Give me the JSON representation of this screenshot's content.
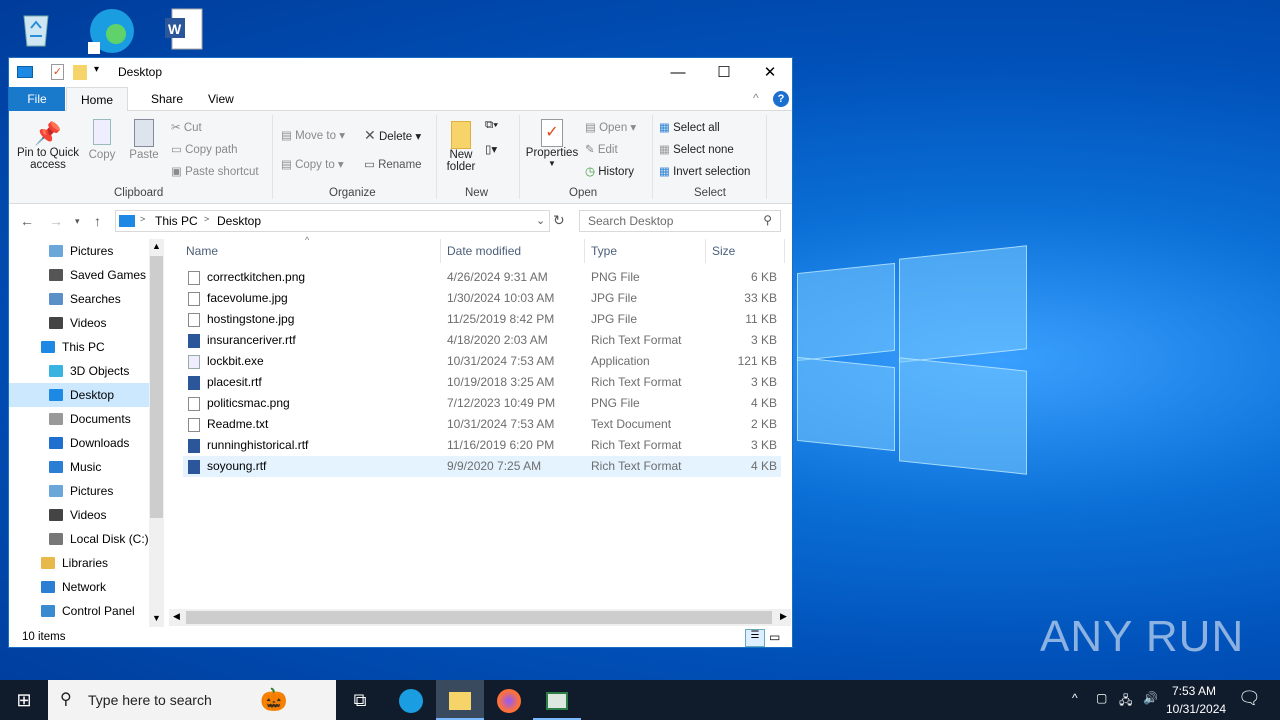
{
  "window": {
    "title": "Desktop",
    "minimize": "—",
    "maximize": "☐",
    "close": "✕"
  },
  "tabs": {
    "file": "File",
    "home": "Home",
    "share": "Share",
    "view": "View"
  },
  "ribbon": {
    "pin": "Pin to Quick access",
    "pin1": "Pin to Quick",
    "pin2": "access",
    "copy": "Copy",
    "paste": "Paste",
    "cut": "Cut",
    "copy_path": "Copy path",
    "paste_shortcut": "Paste shortcut",
    "move_to": "Move to",
    "copy_to": "Copy to",
    "delete": "Delete",
    "rename": "Rename",
    "new_folder1": "New",
    "new_folder2": "folder",
    "properties": "Properties",
    "open": "Open",
    "edit": "Edit",
    "history": "History",
    "select_all": "Select all",
    "select_none": "Select none",
    "invert": "Invert selection",
    "groups": {
      "clipboard": "Clipboard",
      "organize": "Organize",
      "new": "New",
      "open": "Open",
      "select": "Select"
    }
  },
  "address": {
    "crumbs": [
      "This PC",
      "Desktop"
    ],
    "sep": ">",
    "search_placeholder": "Search Desktop"
  },
  "nav": [
    {
      "label": "Pictures",
      "indent": 2,
      "color": "#6aa7d8"
    },
    {
      "label": "Saved Games",
      "indent": 2,
      "color": "#555"
    },
    {
      "label": "Searches",
      "indent": 2,
      "color": "#5a8fc8"
    },
    {
      "label": "Videos",
      "indent": 2,
      "color": "#444"
    },
    {
      "label": "This PC",
      "indent": 1,
      "color": "#1e88e5"
    },
    {
      "label": "3D Objects",
      "indent": 2,
      "color": "#3bb3e0"
    },
    {
      "label": "Desktop",
      "indent": 2,
      "color": "#1e88e5",
      "selected": true
    },
    {
      "label": "Documents",
      "indent": 2,
      "color": "#999"
    },
    {
      "label": "Downloads",
      "indent": 2,
      "color": "#1e6fd0"
    },
    {
      "label": "Music",
      "indent": 2,
      "color": "#2a7fd4"
    },
    {
      "label": "Pictures",
      "indent": 2,
      "color": "#6aa7d8"
    },
    {
      "label": "Videos",
      "indent": 2,
      "color": "#444"
    },
    {
      "label": "Local Disk (C:)",
      "indent": 2,
      "color": "#777"
    },
    {
      "label": "Libraries",
      "indent": 1,
      "color": "#e8b84a"
    },
    {
      "label": "Network",
      "indent": 1,
      "color": "#2a7fd4"
    },
    {
      "label": "Control Panel",
      "indent": 1,
      "color": "#3a8ad0"
    }
  ],
  "columns": {
    "name": "Name",
    "date": "Date modified",
    "type": "Type",
    "size": "Size"
  },
  "files": [
    {
      "name": "correctkitchen.png",
      "date": "4/26/2024 9:31 AM",
      "type": "PNG File",
      "size": "6 KB",
      "kind": "img"
    },
    {
      "name": "facevolume.jpg",
      "date": "1/30/2024 10:03 AM",
      "type": "JPG File",
      "size": "33 KB",
      "kind": "img"
    },
    {
      "name": "hostingstone.jpg",
      "date": "11/25/2019 8:42 PM",
      "type": "JPG File",
      "size": "11 KB",
      "kind": "img"
    },
    {
      "name": "insuranceriver.rtf",
      "date": "4/18/2020 2:03 AM",
      "type": "Rich Text Format",
      "size": "3 KB",
      "kind": "rtf"
    },
    {
      "name": "lockbit.exe",
      "date": "10/31/2024 7:53 AM",
      "type": "Application",
      "size": "121 KB",
      "kind": "exe"
    },
    {
      "name": "placesit.rtf",
      "date": "10/19/2018 3:25 AM",
      "type": "Rich Text Format",
      "size": "3 KB",
      "kind": "rtf"
    },
    {
      "name": "politicsmac.png",
      "date": "7/12/2023 10:49 PM",
      "type": "PNG File",
      "size": "4 KB",
      "kind": "img"
    },
    {
      "name": "Readme.txt",
      "date": "10/31/2024 7:53 AM",
      "type": "Text Document",
      "size": "2 KB",
      "kind": "txt"
    },
    {
      "name": "runninghistorical.rtf",
      "date": "11/16/2019 6:20 PM",
      "type": "Rich Text Format",
      "size": "3 KB",
      "kind": "rtf"
    },
    {
      "name": "soyoung.rtf",
      "date": "9/9/2020 7:25 AM",
      "type": "Rich Text Format",
      "size": "4 KB",
      "kind": "rtf",
      "selected": true
    }
  ],
  "status": {
    "count": "10 items"
  },
  "taskbar": {
    "search_placeholder": "Type here to search",
    "time": "7:53 AM",
    "date": "10/31/2024"
  },
  "watermark": "ANY RUN"
}
